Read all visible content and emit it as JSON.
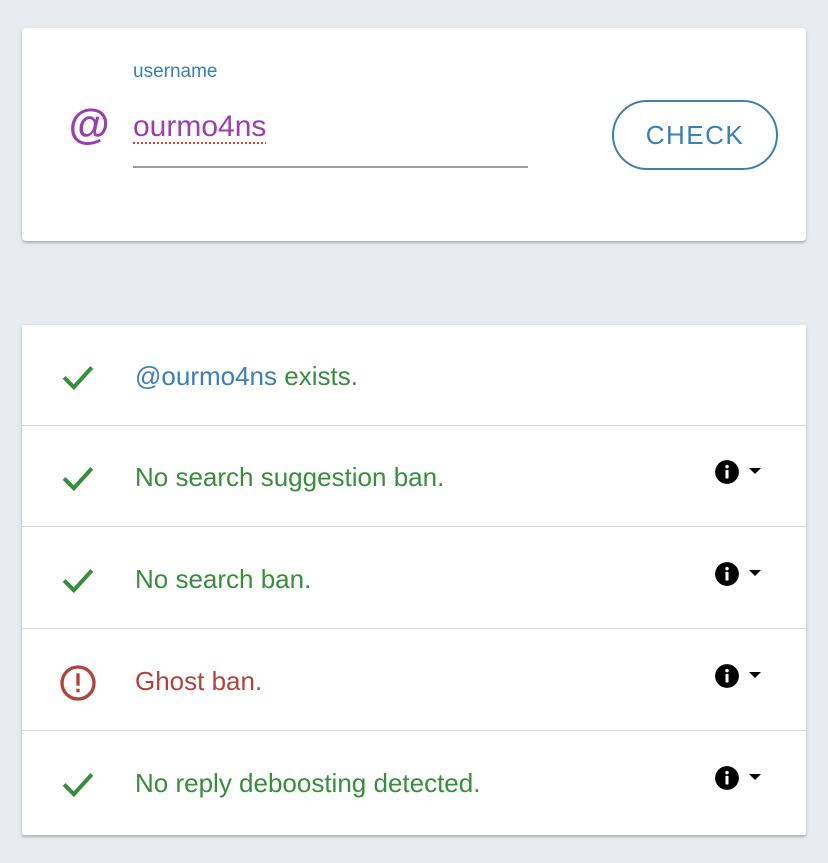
{
  "colors": {
    "page_background": "#e8ecf0",
    "accent_blue": "#3a7fb8",
    "purple": "#9b3fae",
    "success_green": "#388e3c",
    "error_red": "#b0443c"
  },
  "search": {
    "icon": "at-sign-icon",
    "label": "username",
    "value": "ourmo4ns",
    "check_button_label": "CHECK"
  },
  "results": [
    {
      "status": "ok",
      "icon": "check-icon",
      "handle": "@ourmo4ns",
      "text": " exists.",
      "has_info": false
    },
    {
      "status": "ok",
      "icon": "check-icon",
      "text": "No search suggestion ban.",
      "has_info": true
    },
    {
      "status": "ok",
      "icon": "check-icon",
      "text": "No search ban.",
      "has_info": true
    },
    {
      "status": "warning",
      "icon": "alert-circle-icon",
      "text": "Ghost ban.",
      "has_info": true
    },
    {
      "status": "ok",
      "icon": "check-icon",
      "text": "No reply deboosting detected.",
      "has_info": true
    }
  ]
}
